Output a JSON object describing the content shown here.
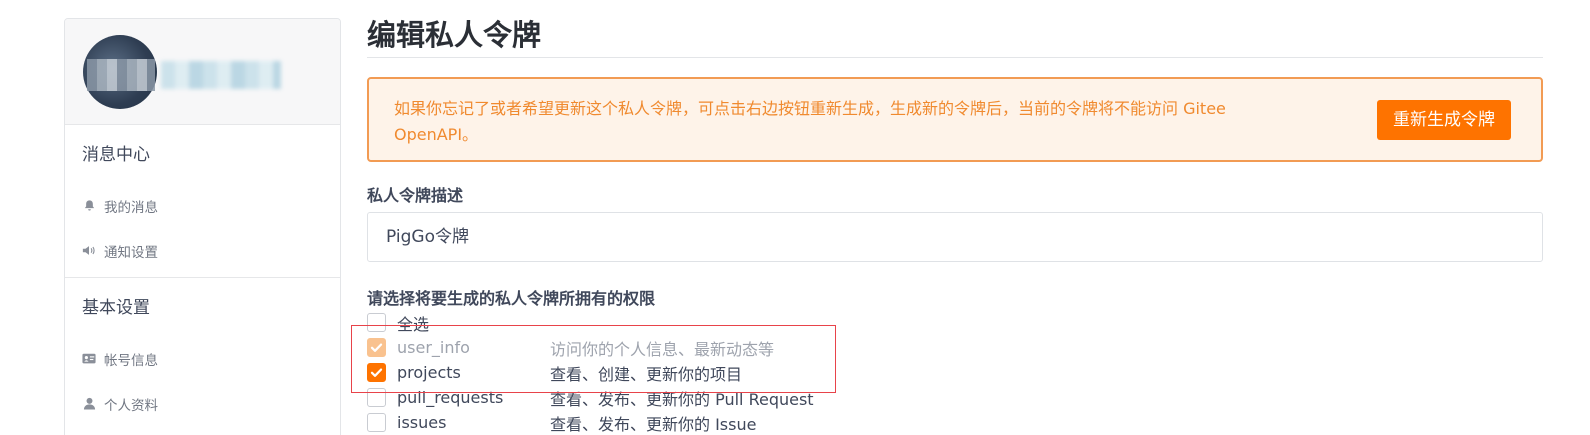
{
  "sidebar": {
    "groups": [
      {
        "title": "消息中心",
        "items": [
          {
            "label": "我的消息",
            "icon": "bell-icon"
          },
          {
            "label": "通知设置",
            "icon": "speaker-icon"
          }
        ]
      },
      {
        "title": "基本设置",
        "items": [
          {
            "label": "帐号信息",
            "icon": "id-card-icon"
          },
          {
            "label": "个人资料",
            "icon": "user-icon"
          }
        ]
      }
    ]
  },
  "main": {
    "title": "编辑私人令牌",
    "warning": {
      "text": "如果你忘记了或者希望更新这个私人令牌，可点击右边按钮重新生成，生成新的令牌后，当前的令牌将不能访问 Gitee OpenAPI。",
      "button_label": "重新生成令牌"
    },
    "description_label": "私人令牌描述",
    "description_value": "PigGo令牌",
    "permissions_label": "请选择将要生成的私人令牌所拥有的权限",
    "select_all_label": "全选",
    "permissions": [
      {
        "name": "user_info",
        "desc": "访问你的个人信息、最新动态等",
        "state": "checked-disabled"
      },
      {
        "name": "projects",
        "desc": "查看、创建、更新你的项目",
        "state": "checked"
      },
      {
        "name": "pull_requests",
        "desc": "查看、发布、更新你的 Pull Request",
        "state": "unchecked"
      },
      {
        "name": "issues",
        "desc": "查看、发布、更新你的 Issue",
        "state": "unchecked"
      }
    ]
  },
  "colors": {
    "accent": "#fe7300",
    "warning_bg": "#fef3e9",
    "warning_border": "#f29b53",
    "highlight_border": "#e8434a"
  }
}
